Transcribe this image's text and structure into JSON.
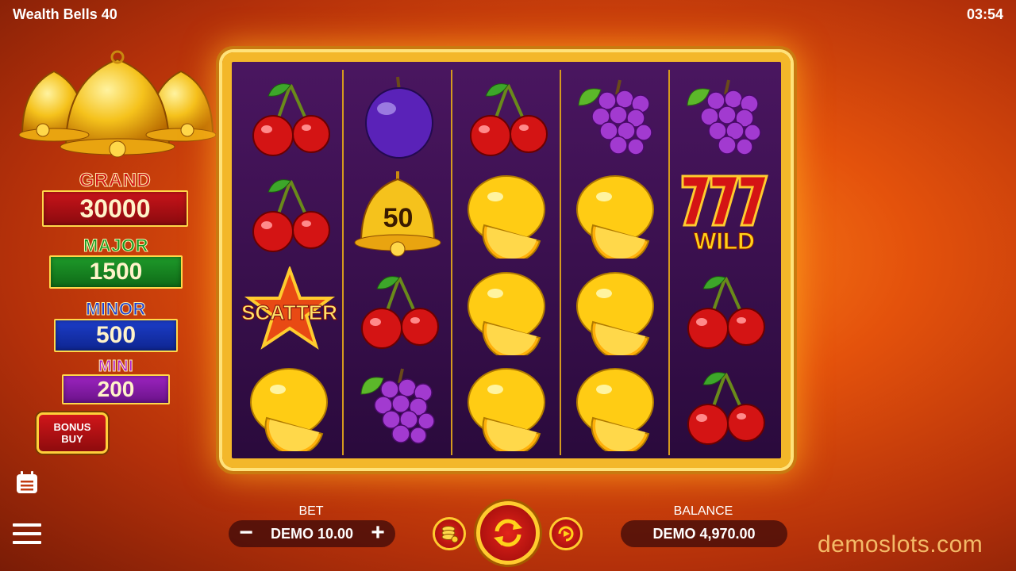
{
  "header": {
    "title": "Wealth Bells 40",
    "time": "03:54"
  },
  "jackpots": {
    "grand": {
      "label": "GRAND",
      "value": "30000"
    },
    "major": {
      "label": "MAJOR",
      "value": "1500"
    },
    "minor": {
      "label": "MINOR",
      "value": "500"
    },
    "mini": {
      "label": "MINI",
      "value": "200"
    }
  },
  "bonus_buy": {
    "line1": "BONUS",
    "line2": "BUY"
  },
  "reels": [
    [
      "cherry",
      "cherry",
      "scatter-star",
      "lemon"
    ],
    [
      "plum",
      "golden-bell",
      "cherry",
      "grapes"
    ],
    [
      "cherry",
      "lemon",
      "lemon",
      "lemon"
    ],
    [
      "grapes",
      "lemon",
      "lemon",
      "lemon"
    ],
    [
      "grapes",
      "seven-wild",
      "cherry",
      "cherry"
    ]
  ],
  "symbols": {
    "bell_value": "50",
    "scatter_label": "SCATTER",
    "wild_label": "WILD"
  },
  "bet": {
    "label": "BET",
    "value": "DEMO 10.00",
    "minus": "−",
    "plus": "+"
  },
  "balance": {
    "label": "BALANCE",
    "value": "DEMO 4,970.00"
  },
  "watermark": "demoslots.com",
  "colors": {
    "grand": "#d11818",
    "major": "#139a21",
    "minor": "#1b3fd6",
    "mini": "#b21ad0",
    "frame_gold": "#f3b72a",
    "reel_bg": "#3a1050",
    "spin_red": "#e2241a"
  }
}
